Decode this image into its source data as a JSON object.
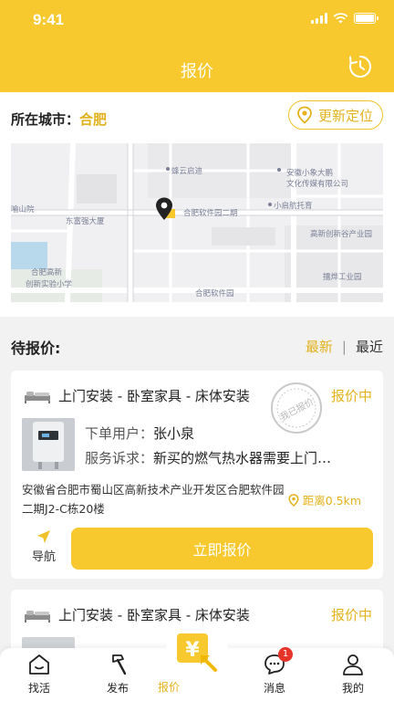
{
  "status_bar": {
    "time": "9:41"
  },
  "nav": {
    "title": "报价",
    "history_icon": "clock-history-icon"
  },
  "location": {
    "label": "所在城市：",
    "city": "合肥",
    "relocate_label": "更新定位"
  },
  "map": {
    "labels": [
      "蜂云启迪",
      "安徽小象大鹏",
      "文化传媒有限公司",
      "东富强大厦",
      "合肥软件园二期",
      "小启航托育",
      "高新创新谷产业园",
      "合肥高新",
      "创新实验小学",
      "擂烨工业园",
      "合肥软件园",
      "喻山院"
    ]
  },
  "pending": {
    "label": "待报价:",
    "sort_newest": "最新",
    "sort_separator": "|",
    "sort_nearest": "最近"
  },
  "orders": [
    {
      "title": "上门安装 - 卧室家具 - 床体安装",
      "status": "报价中",
      "stamp_text": "我已报价",
      "user_label": "下单用户：",
      "user_name": "张小泉",
      "request_label": "服务诉求：",
      "request_text": "新买的燃气热水器需要上门…",
      "address": "安徽省合肥市蜀山区高新技术产业开发区合肥软件园二期J2-C栋20楼",
      "distance": "距离0.5km",
      "nav_label": "导航",
      "quote_button": "立即报价"
    },
    {
      "title": "上门安装 - 卧室家具 - 床体安装",
      "status": "报价中"
    }
  ],
  "tabbar": {
    "items": [
      {
        "label": "找活",
        "icon": "home-icon"
      },
      {
        "label": "发布",
        "icon": "hammer-icon"
      },
      {
        "label": "报价",
        "icon": "yen-quote-icon"
      },
      {
        "label": "消息",
        "icon": "chat-icon",
        "badge": "1"
      },
      {
        "label": "我的",
        "icon": "user-icon"
      }
    ]
  },
  "colors": {
    "brand": "#f7c92e",
    "accent_text": "#e3b21c",
    "badge": "#e6342b"
  }
}
